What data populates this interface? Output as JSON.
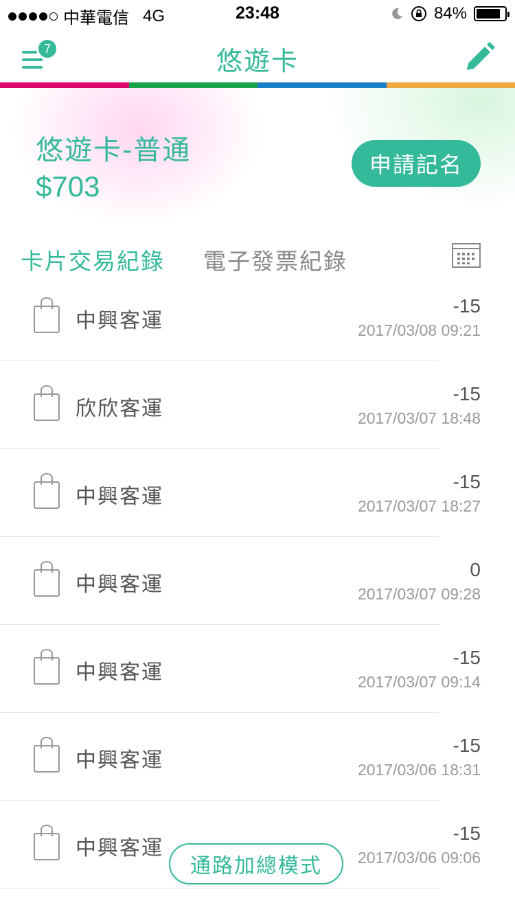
{
  "status_bar": {
    "carrier": "中華電信",
    "network": "4G",
    "time": "23:48",
    "battery": "84%",
    "battery_level": 0.84
  },
  "nav": {
    "title": "悠遊卡",
    "badge_count": "7"
  },
  "colors": {
    "accent": "#34b99a",
    "strip": [
      "#e0086e",
      "#1aa44a",
      "#1a7fc4",
      "#f0a840"
    ]
  },
  "card": {
    "name": "悠遊卡-普通",
    "balance": "$703",
    "register_label": "申請記名"
  },
  "tabs": {
    "active": "卡片交易紀錄",
    "inactive": "電子發票紀錄"
  },
  "transactions": [
    {
      "name": "中興客運",
      "amount": "-15",
      "date": "2017/03/08 09:21"
    },
    {
      "name": "欣欣客運",
      "amount": "-15",
      "date": "2017/03/07 18:48"
    },
    {
      "name": "中興客運",
      "amount": "-15",
      "date": "2017/03/07 18:27"
    },
    {
      "name": "中興客運",
      "amount": "0",
      "date": "2017/03/07 09:28"
    },
    {
      "name": "中興客運",
      "amount": "-15",
      "date": "2017/03/07 09:14"
    },
    {
      "name": "中興客運",
      "amount": "-15",
      "date": "2017/03/06 18:31"
    },
    {
      "name": "中興客運",
      "amount": "-15",
      "date": "2017/03/06 09:06"
    }
  ],
  "mode_button": "通路加總模式"
}
